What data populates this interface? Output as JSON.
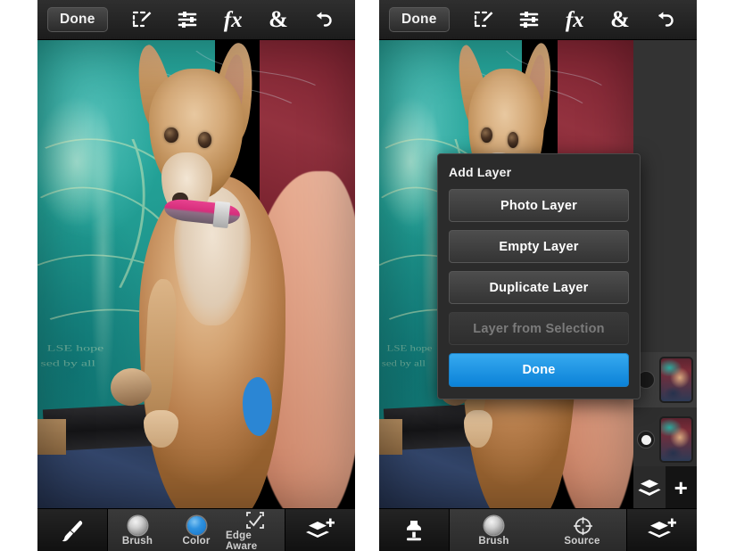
{
  "app": {
    "name": "Photo editor mobile app",
    "panels": [
      {
        "id": "panel-left",
        "name": "Brush tool screen",
        "topbar": {
          "done_label": "Done",
          "icons": [
            {
              "name": "selection-edit-icon",
              "glyph": "marquee-pencil"
            },
            {
              "name": "adjustments-icon",
              "glyph": "sliders"
            },
            {
              "name": "effects-icon",
              "glyph": "fx"
            },
            {
              "name": "blend-icon",
              "glyph": "&"
            },
            {
              "name": "undo-icon",
              "glyph": "undo-arrow"
            }
          ]
        },
        "bottombar": {
          "tool_icon": "paintbrush-icon",
          "items": [
            {
              "name": "brush-option",
              "label": "Brush",
              "icon": "brush-size-knob",
              "color": "#cfcfcf"
            },
            {
              "name": "color-option",
              "label": "Color",
              "icon": "color-swatch-knob",
              "color": "#2f92e0"
            },
            {
              "name": "edge-aware-option",
              "label": "Edge Aware",
              "icon": "edge-aware-icon",
              "color": "#cfcfcf"
            }
          ],
          "layers_icon": "add-layer-icon"
        }
      },
      {
        "id": "panel-right",
        "name": "Clone stamp screen with Add Layer dialog",
        "topbar": {
          "done_label": "Done",
          "icons": [
            {
              "name": "selection-edit-icon",
              "glyph": "marquee-pencil"
            },
            {
              "name": "adjustments-icon",
              "glyph": "sliders"
            },
            {
              "name": "effects-icon",
              "glyph": "fx"
            },
            {
              "name": "blend-icon",
              "glyph": "&"
            },
            {
              "name": "undo-icon",
              "glyph": "undo-arrow"
            }
          ]
        },
        "dialog": {
          "title": "Add Layer",
          "buttons": [
            {
              "name": "photo-layer-button",
              "label": "Photo Layer",
              "state": "enabled"
            },
            {
              "name": "empty-layer-button",
              "label": "Empty Layer",
              "state": "enabled"
            },
            {
              "name": "duplicate-layer-button",
              "label": "Duplicate Layer",
              "state": "enabled"
            },
            {
              "name": "layer-from-selection-button",
              "label": "Layer from Selection",
              "state": "disabled"
            }
          ],
          "primary": {
            "name": "dialog-done-button",
            "label": "Done",
            "color": "#1f96e5"
          }
        },
        "layers_rail": {
          "layers": [
            {
              "name": "layer-thumbnail-upper",
              "selected": false
            },
            {
              "name": "layer-thumbnail-lower",
              "selected": true
            }
          ],
          "buttons": [
            {
              "name": "layers-button",
              "icon": "layers-icon"
            },
            {
              "name": "add-layer-button",
              "icon": "plus-icon",
              "label": "+"
            }
          ]
        },
        "bottombar": {
          "tool_icon": "clone-stamp-icon",
          "items": [
            {
              "name": "brush-option",
              "label": "Brush",
              "icon": "brush-size-knob",
              "color": "#cfcfcf"
            },
            {
              "name": "source-option",
              "label": "Source",
              "icon": "source-target-icon",
              "color": "#cfcfcf"
            }
          ],
          "layers_icon": "add-layer-icon"
        }
      }
    ]
  },
  "photo": {
    "name": "dog-photo",
    "description": "Small tan chihuahua-mix dog with pink collar lying against a teal printed shirt and a person's arm",
    "edit_mark": {
      "name": "blue-paint-blob",
      "color": "#2b86d4"
    }
  },
  "colors": {
    "toolbar_dark": "#1c1c1c",
    "panel_dark": "#2b2b2b",
    "accent_blue": "#1f96e5",
    "label_gray": "#cfcfcf",
    "disabled_gray": "#7b7b7b",
    "background": "#ffffff"
  }
}
